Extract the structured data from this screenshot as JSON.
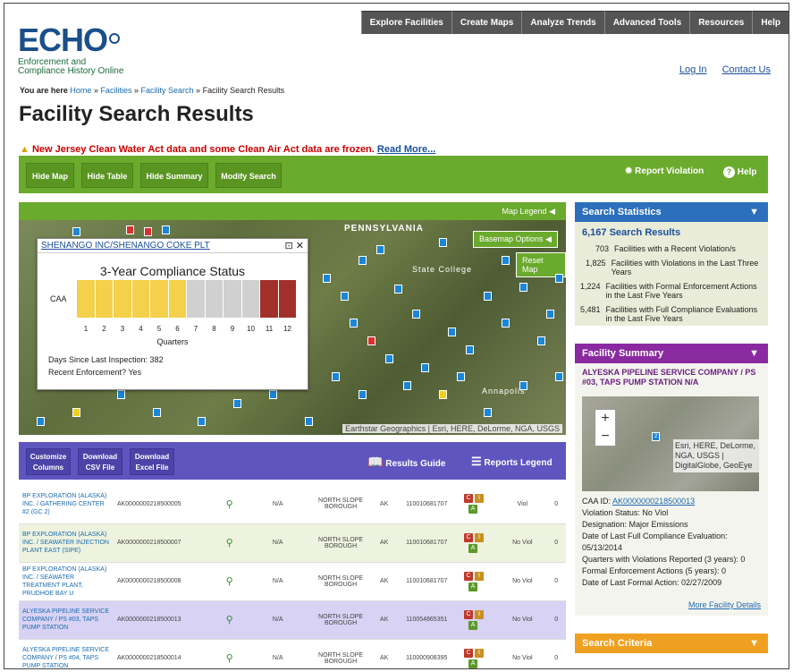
{
  "nav": {
    "items": [
      "Explore Facilities",
      "Create Maps",
      "Analyze Trends",
      "Advanced Tools",
      "Resources",
      "Help"
    ]
  },
  "logo": {
    "title": "ECHO",
    "sub1": "Enforcement and",
    "sub2": "Compliance History Online"
  },
  "toplinks": {
    "login": "Log In",
    "contact": "Contact Us"
  },
  "breadcrumb": {
    "prefix": "You are here",
    "home": "Home",
    "facilities": "Facilities",
    "search": "Facility Search",
    "current": "Facility Search Results",
    "sep": "»"
  },
  "page_title": "Facility Search Results",
  "alert": {
    "text": "New Jersey Clean Water Act data and some Clean Air Act data are frozen.",
    "link": "Read More..."
  },
  "toolbar": {
    "hide_map": "Hide Map",
    "hide_table": "Hide Table",
    "hide_summary": "Hide Summary",
    "modify_search": "Modify Search",
    "report_violation": "Report Violation",
    "help": "Help"
  },
  "map": {
    "legend": "Map Legend",
    "basemap": "Basemap Options",
    "reset": "Reset Map",
    "attribution": "Earthstar Geographics | Esri, HERE, DeLorme, NGA, USGS",
    "labels": {
      "state": "PENNSYLVANIA",
      "college": "State College",
      "annapolis": "Annapolis"
    }
  },
  "popup": {
    "facility": "SHENANGO INC/SHENANGO COKE PLT",
    "chart_title": "3-Year Compliance Status",
    "program": "CAA",
    "axis_label": "Quarters",
    "quarters": [
      "1",
      "2",
      "3",
      "4",
      "5",
      "6",
      "7",
      "8",
      "9",
      "10",
      "11",
      "12"
    ],
    "days_label": "Days Since Last Inspection: 382",
    "enforcement_label": "Recent Enforcement? Yes",
    "colors": [
      "#f5d04a",
      "#f5d04a",
      "#f5d04a",
      "#f5d04a",
      "#f5d04a",
      "#f5d04a",
      "#d0d0d0",
      "#d0d0d0",
      "#d0d0d0",
      "#d0d0d0",
      "#a1302a",
      "#a1302a"
    ]
  },
  "table_toolbar": {
    "customize1": "Customize",
    "customize2": "Columns",
    "csv1": "Download",
    "csv2": "CSV File",
    "excel1": "Download",
    "excel2": "Excel File",
    "results_guide": "Results Guide",
    "reports_legend": "Reports Legend"
  },
  "rows": [
    {
      "name": "BP EXPLORATION (ALASKA) INC. / GATHERING CENTER #2 (GC 2)",
      "id": "AK0000000218500005",
      "na": "N/A",
      "county": "NORTH SLOPE BOROUGH",
      "state": "AK",
      "frs": "110010681707",
      "viol": "Viol",
      "n": "0"
    },
    {
      "name": "BP EXPLORATION (ALASKA) INC. / SEAWATER INJECTION PLANT EAST (SIPE)",
      "id": "AK0000000218500007",
      "na": "N/A",
      "county": "NORTH SLOPE BOROUGH",
      "state": "AK",
      "frs": "110010681707",
      "viol": "No Viol",
      "n": "0"
    },
    {
      "name": "BP EXPLORATION (ALASKA) INC. / SEAWATER TREATMENT PLANT, PRUDHOE BAY U",
      "id": "AK0000000218500008",
      "na": "N/A",
      "county": "NORTH SLOPE BOROUGH",
      "state": "AK",
      "frs": "110010681707",
      "viol": "No Viol",
      "n": "0"
    },
    {
      "name": "ALYESKA PIPELINE SERVICE COMPANY / PS #03, TAPS PUMP STATION",
      "id": "AK0000000218500013",
      "na": "N/A",
      "county": "NORTH SLOPE BOROUGH",
      "state": "AK",
      "frs": "110054865351",
      "viol": "No Viol",
      "n": "0"
    },
    {
      "name": "ALYESKA PIPELINE SERVICE COMPANY / PS #04, TAPS PUMP STATION",
      "id": "AK0000000218500014",
      "na": "N/A",
      "county": "NORTH SLOPE BOROUGH",
      "state": "AK",
      "frs": "110000908395",
      "viol": "No Viol",
      "n": "0"
    }
  ],
  "stats": {
    "header": "Search Statistics",
    "results": "6,167 Search Results",
    "rows": [
      {
        "n": "703",
        "t": "Facilities with a Recent Violation/s"
      },
      {
        "n": "1,825",
        "t": "Facilities with Violations in the Last Three Years"
      },
      {
        "n": "1,224",
        "t": "Facilities with Formal Enforcement Actions in the Last Five Years"
      },
      {
        "n": "5,481",
        "t": "Facilities with Full Compliance Evaluations in the Last Five Years"
      }
    ]
  },
  "summary": {
    "header": "Facility Summary",
    "name": "ALYESKA PIPELINE SERVICE COMPANY / PS #03, TAPS PUMP STATION N/A",
    "mini_attrib": "Esri, HERE, DeLorme, NGA, USGS | DigitalGlobe, GeoEye",
    "caa_label": "CAA ID:",
    "caa_id": "AK0000000218500013",
    "lines": [
      "Violation Status: No Viol",
      "Designation: Major Emissions",
      "Date of Last Full Compliance Evaluation: 05/13/2014",
      "Quarters with Violations Reported (3 years): 0",
      "Formal Enforcement Actions (5 years): 0",
      "Date of Last Formal Action: 02/27/2009"
    ],
    "more": "More Facility Details"
  },
  "criteria": {
    "header": "Search Criteria"
  }
}
